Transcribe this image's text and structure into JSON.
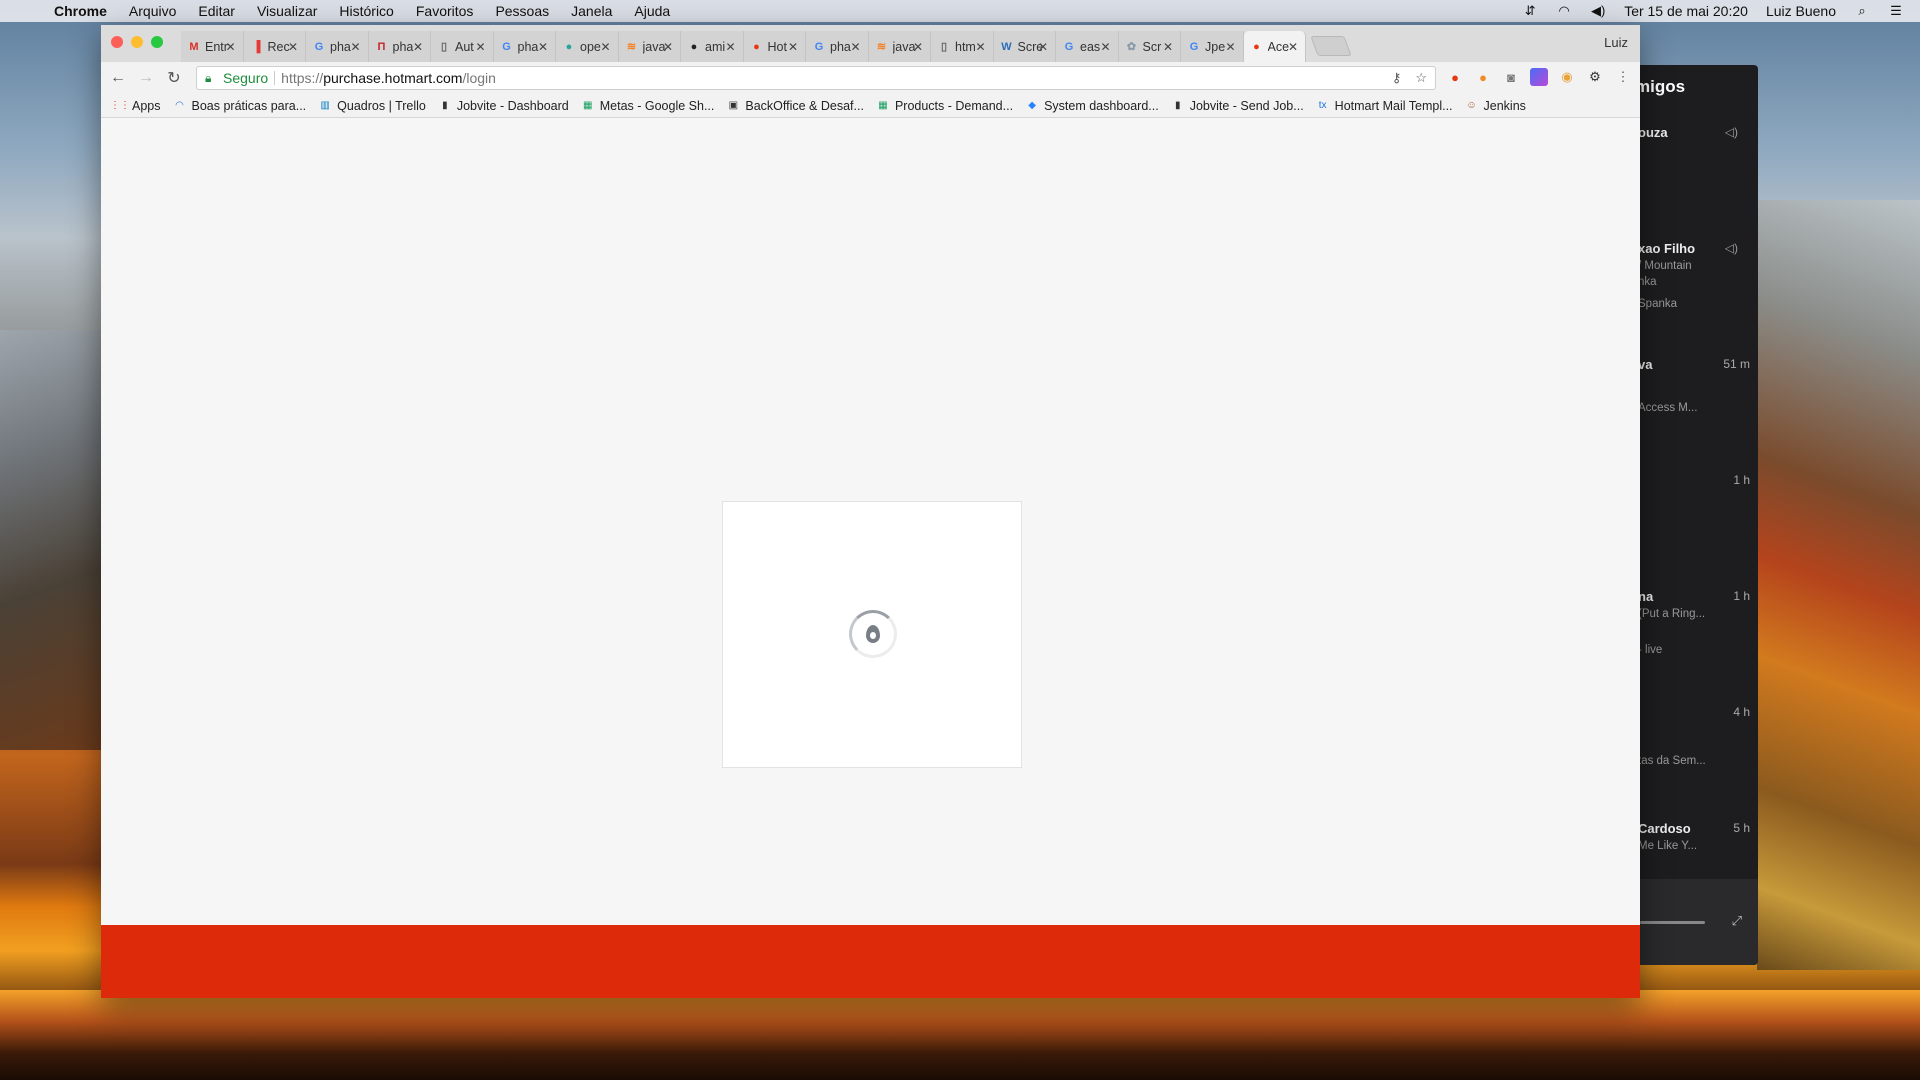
{
  "menubar": {
    "app_name": "Chrome",
    "menus": [
      "Arquivo",
      "Editar",
      "Visualizar",
      "Histórico",
      "Favoritos",
      "Pessoas",
      "Janela",
      "Ajuda"
    ],
    "datetime": "Ter 15 de mai  20:20",
    "user": "Luiz Bueno"
  },
  "browser": {
    "tabs": [
      {
        "label": "Entr",
        "icon": "gmail-icon",
        "glyph": "M",
        "color": "#d93025"
      },
      {
        "label": "Rec",
        "icon": "red-doc-icon",
        "glyph": "▐",
        "color": "#e53935"
      },
      {
        "label": "pha",
        "icon": "google-icon",
        "glyph": "G",
        "color": "#4285f4"
      },
      {
        "label": "pha",
        "icon": "red-bracket-icon",
        "glyph": "П",
        "color": "#c62828"
      },
      {
        "label": "Aut",
        "icon": "page-icon",
        "glyph": "▯",
        "color": "#666666"
      },
      {
        "label": "pha",
        "icon": "google-icon",
        "glyph": "G",
        "color": "#4285f4"
      },
      {
        "label": "ope",
        "icon": "teal-icon",
        "glyph": "●",
        "color": "#26a69a"
      },
      {
        "label": "java",
        "icon": "stack-icon",
        "glyph": "≋",
        "color": "#f48024"
      },
      {
        "label": "ami",
        "icon": "github-icon",
        "glyph": "●",
        "color": "#222222"
      },
      {
        "label": "Hot",
        "icon": "hotmart-icon",
        "glyph": "●",
        "color": "#e63912"
      },
      {
        "label": "pha",
        "icon": "google-icon",
        "glyph": "G",
        "color": "#4285f4"
      },
      {
        "label": "java",
        "icon": "stack-icon",
        "glyph": "≋",
        "color": "#f48024"
      },
      {
        "label": "htm",
        "icon": "page-icon",
        "glyph": "▯",
        "color": "#666666"
      },
      {
        "label": "Scre",
        "icon": "w3-icon",
        "glyph": "W",
        "color": "#2a6ebb"
      },
      {
        "label": "eas",
        "icon": "google-icon",
        "glyph": "G",
        "color": "#4285f4"
      },
      {
        "label": "Scr",
        "icon": "puzzle-icon",
        "glyph": "✿",
        "color": "#8a9aaa"
      },
      {
        "label": "Jpe",
        "icon": "google-icon",
        "glyph": "G",
        "color": "#4285f4"
      },
      {
        "label": "Ace",
        "icon": "hotmart-icon",
        "glyph": "●",
        "color": "#e63912",
        "active": true
      }
    ],
    "profile_name": "Luiz",
    "address": {
      "secure_label": "Seguro",
      "scheme": "https://",
      "host": "purchase.hotmart.com",
      "path": "/login"
    },
    "bookmarks": [
      {
        "label": "Apps",
        "icon": "apps-grid-icon",
        "glyph": "⋮⋮",
        "color": "#d93025"
      },
      {
        "label": "Boas práticas para...",
        "icon": "loading-icon",
        "glyph": "◠",
        "color": "#3c78d8"
      },
      {
        "label": "Quadros | Trello",
        "icon": "trello-icon",
        "glyph": "▥",
        "color": "#0079bf"
      },
      {
        "label": "Jobvite - Dashboard",
        "icon": "jobvite-icon",
        "glyph": "▮",
        "color": "#333333"
      },
      {
        "label": "Metas - Google Sh...",
        "icon": "sheets-icon",
        "glyph": "▦",
        "color": "#0f9d58"
      },
      {
        "label": "BackOffice & Desaf...",
        "icon": "board-icon",
        "glyph": "▣",
        "color": "#333333"
      },
      {
        "label": "Products - Demand...",
        "icon": "sheets-icon",
        "glyph": "▦",
        "color": "#0f9d58"
      },
      {
        "label": "System dashboard...",
        "icon": "jira-icon",
        "glyph": "◆",
        "color": "#2684ff"
      },
      {
        "label": "Jobvite - Send Job...",
        "icon": "jobvite-icon",
        "glyph": "▮",
        "color": "#333333"
      },
      {
        "label": "Hotmart Mail Templ...",
        "icon": "tx-icon",
        "glyph": "tx",
        "color": "#1a73e8"
      },
      {
        "label": "Jenkins",
        "icon": "jenkins-icon",
        "glyph": "☺",
        "color": "#a0522d"
      }
    ]
  },
  "side_panel": {
    "title": "migos",
    "entries": [
      {
        "name": "ouza",
        "subtitle": "",
        "extra": "",
        "time": "",
        "speaker": true
      },
      {
        "name": "xao Filho",
        "subtitle": "/ Mountain",
        "extra": "nka",
        "extra2": "Spanka",
        "time": "",
        "speaker": true
      },
      {
        "name": "va",
        "subtitle": "",
        "extra": "Access M...",
        "time": "51 m",
        "speaker": false
      },
      {
        "name": "",
        "subtitle": "",
        "extra": "",
        "time": "1 h",
        "speaker": false
      },
      {
        "name": "na",
        "subtitle": "(Put a Ring...",
        "extra": "- live",
        "time": "1 h",
        "speaker": false
      },
      {
        "name": "",
        "subtitle": "tas da Sem...",
        "extra": "",
        "time": "4 h",
        "speaker": false
      },
      {
        "name": "Cardoso",
        "subtitle": "Me Like Y...",
        "extra": "",
        "time": "5 h",
        "speaker": false
      }
    ]
  },
  "colors": {
    "hotmart_red": "#dc2a0b",
    "secure_green": "#1e8e3e"
  }
}
